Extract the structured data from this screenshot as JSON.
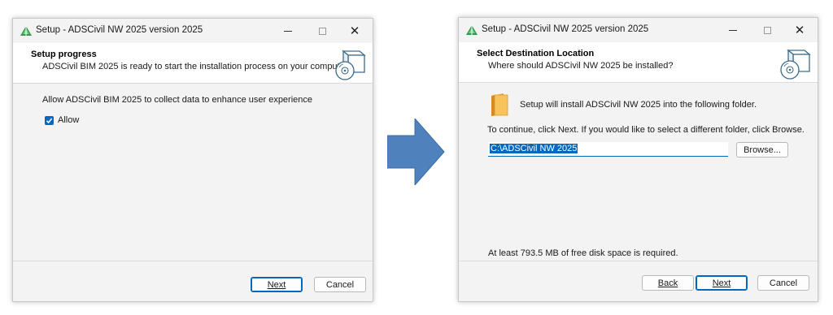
{
  "colors": {
    "accent": "#0067c0",
    "arrow": "#4f81bd",
    "window_bg": "#f3f3f3"
  },
  "icons": {
    "app": "green-triangle-icon",
    "header": "software-box-cd-icon",
    "folder": "folder-icon",
    "arrow": "right-arrow-icon"
  },
  "window1": {
    "title": "Setup - ADSCivil NW 2025 version 2025",
    "header_title": "Setup progress",
    "header_sub": "ADSCivil BIM 2025 is ready to start the installation process on your computer.",
    "consent_text": "Allow ADSCivil BIM 2025 to collect data to enhance user experience",
    "allow_label": "Allow",
    "allow_checked": true,
    "next_label": "Next",
    "cancel_label": "Cancel"
  },
  "window2": {
    "title": "Setup - ADSCivil NW 2025 version 2025",
    "header_title": "Select Destination Location",
    "header_sub": "Where should ADSCivil NW 2025 be installed?",
    "install_text": "Setup will install ADSCivil NW 2025 into the following folder.",
    "continue_text": "To continue, click Next. If you would like to select a different folder, click Browse.",
    "path_value": "C:\\ADSCivil NW 2025",
    "browse_label": "Browse...",
    "disk_text": "At least 793.5 MB of free disk space is required.",
    "back_label": "Back",
    "next_label": "Next",
    "cancel_label": "Cancel"
  }
}
